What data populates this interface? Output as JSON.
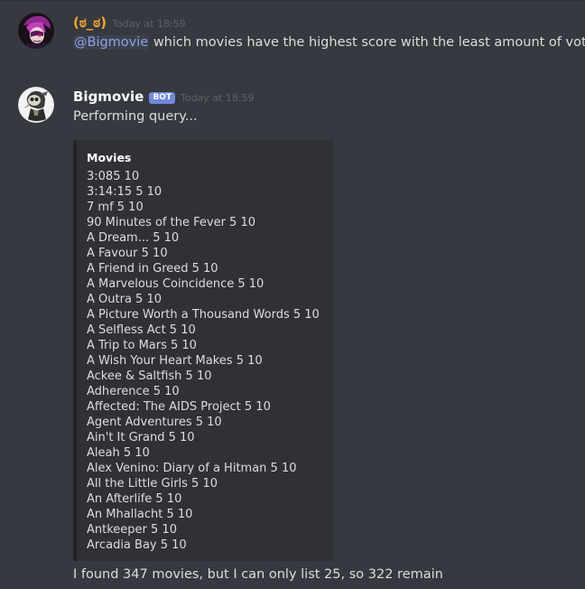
{
  "messages": [
    {
      "username": "(ಠ_ಠ)",
      "timestamp": "Today at 18:59",
      "mention": "@Bigmovie",
      "text": " which movies have the highest score with the least amount of votes?",
      "colors": {
        "username": "#f0a732"
      }
    },
    {
      "username": "Bigmovie",
      "bot_tag": "BOT",
      "timestamp": "Today at 18:59",
      "text": "Performing query...",
      "embed": {
        "title": "Movies",
        "items": [
          "3:085 10",
          "3:14:15 5 10",
          "7 mf 5 10",
          "90 Minutes of the Fever 5 10",
          "A Dream... 5 10",
          "A Favour 5 10",
          "A Friend in Greed 5 10",
          "A Marvelous Coincidence 5 10",
          "A Outra 5 10",
          "A Picture Worth a Thousand Words 5 10",
          "A Selfless Act 5 10",
          "A Trip to Mars 5 10",
          "A Wish Your Heart Makes 5 10",
          "Ackee & Saltfish 5 10",
          "Adherence 5 10",
          "Affected: The AIDS Project 5 10",
          "Agent Adventures 5 10",
          "Ain't It Grand 5 10",
          "Aleah 5 10",
          "Alex Venino: Diary of a Hitman 5 10",
          "All the Little Girls 5 10",
          "An Afterlife 5 10",
          "An Mhallacht 5 10",
          "Antkeeper 5 10",
          "Arcadia Bay 5 10"
        ]
      },
      "footer_text": "I found 347 movies, but I can only list 25, so 322 remain"
    }
  ],
  "icons": {
    "user_avatar": "purple-haired-face-avatar",
    "bot_avatar": "skull-plague-mask-avatar"
  },
  "colors": {
    "background": "#36393f",
    "embed_background": "#2f3136",
    "mention": "#8ea1e1",
    "bot_tag": "#7289da"
  }
}
